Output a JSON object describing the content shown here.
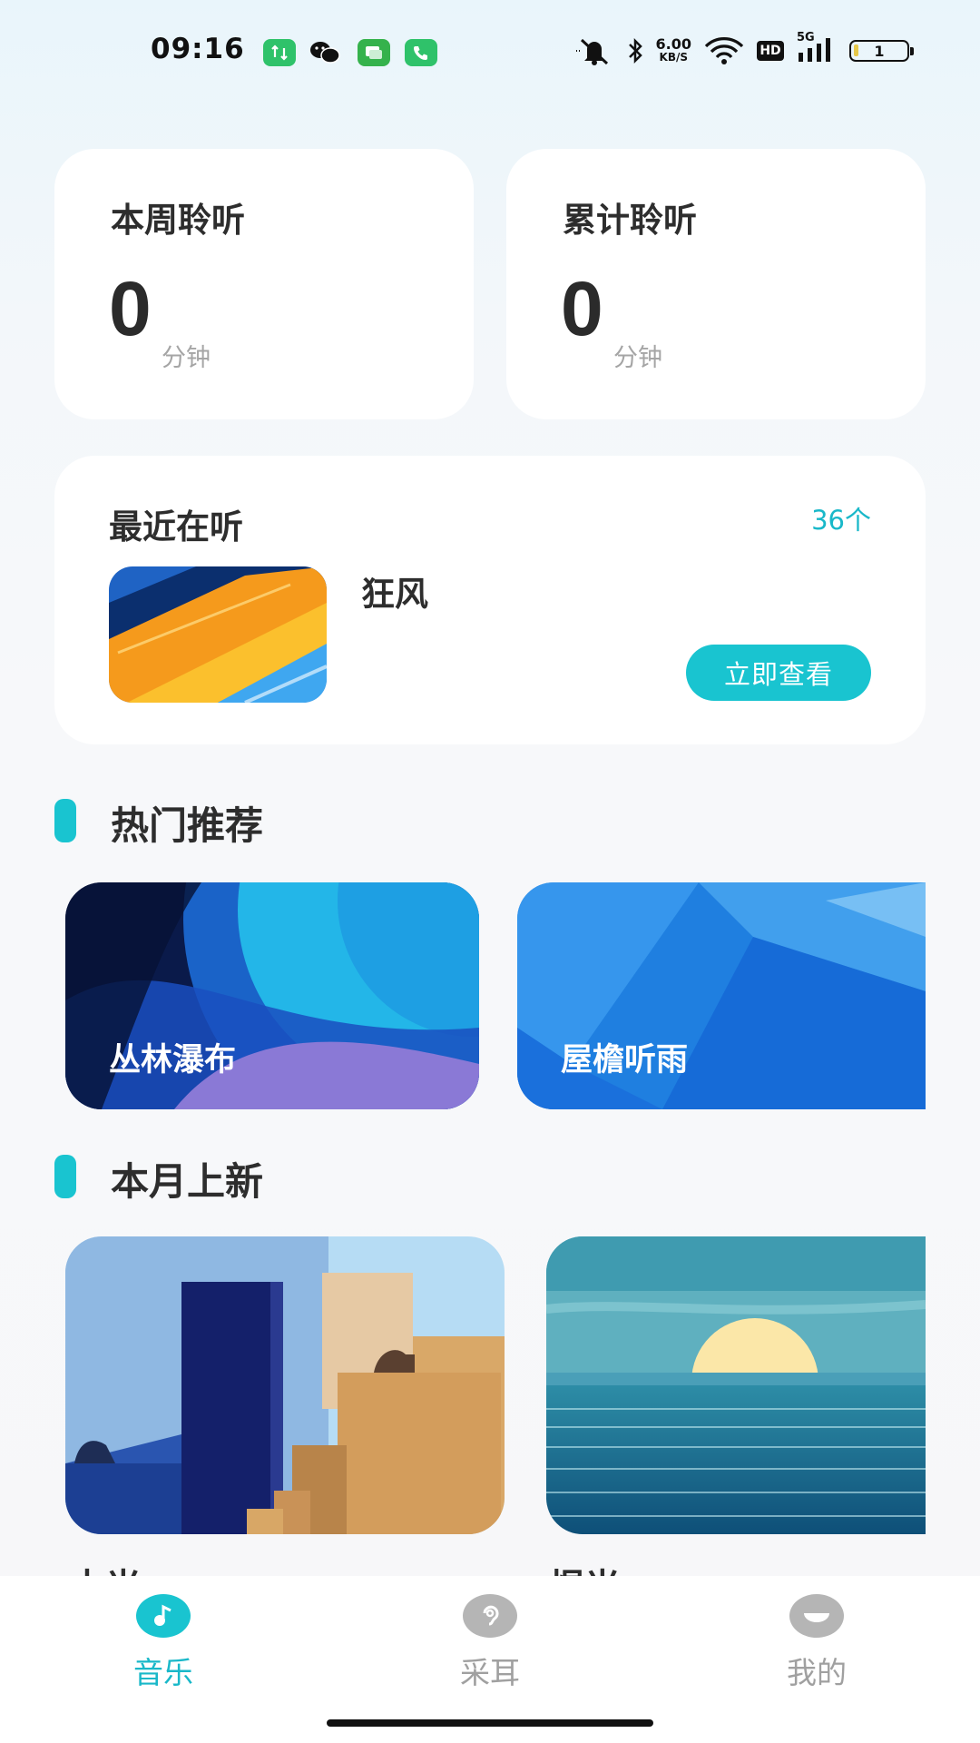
{
  "status_bar": {
    "time": "09:16",
    "net_speed": "6.00",
    "net_unit": "KB/S",
    "hd": "HD",
    "signal": "5G",
    "battery": "1"
  },
  "stats": {
    "week": {
      "title": "本周聆听",
      "value": "0",
      "unit": "分钟"
    },
    "total": {
      "title": "累计聆听",
      "value": "0",
      "unit": "分钟"
    }
  },
  "recent": {
    "title": "最近在听",
    "count": "36个",
    "song": "狂风",
    "button": "立即查看"
  },
  "hot": {
    "title": "热门推荐",
    "items": [
      {
        "label": "丛林瀑布"
      },
      {
        "label": "屋檐听雨"
      }
    ]
  },
  "new": {
    "title": "本月上新",
    "items": [
      {
        "label": "木光"
      },
      {
        "label": "煜光"
      }
    ]
  },
  "nav": {
    "items": [
      {
        "label": "音乐",
        "active": true,
        "color": "#19b8c9"
      },
      {
        "label": "采耳",
        "active": false,
        "color": "#a0a0a0"
      },
      {
        "label": "我的",
        "active": false,
        "color": "#a0a0a0"
      }
    ]
  },
  "colors": {
    "accent": "#19c4d0",
    "accent_text": "#19b8c9"
  }
}
